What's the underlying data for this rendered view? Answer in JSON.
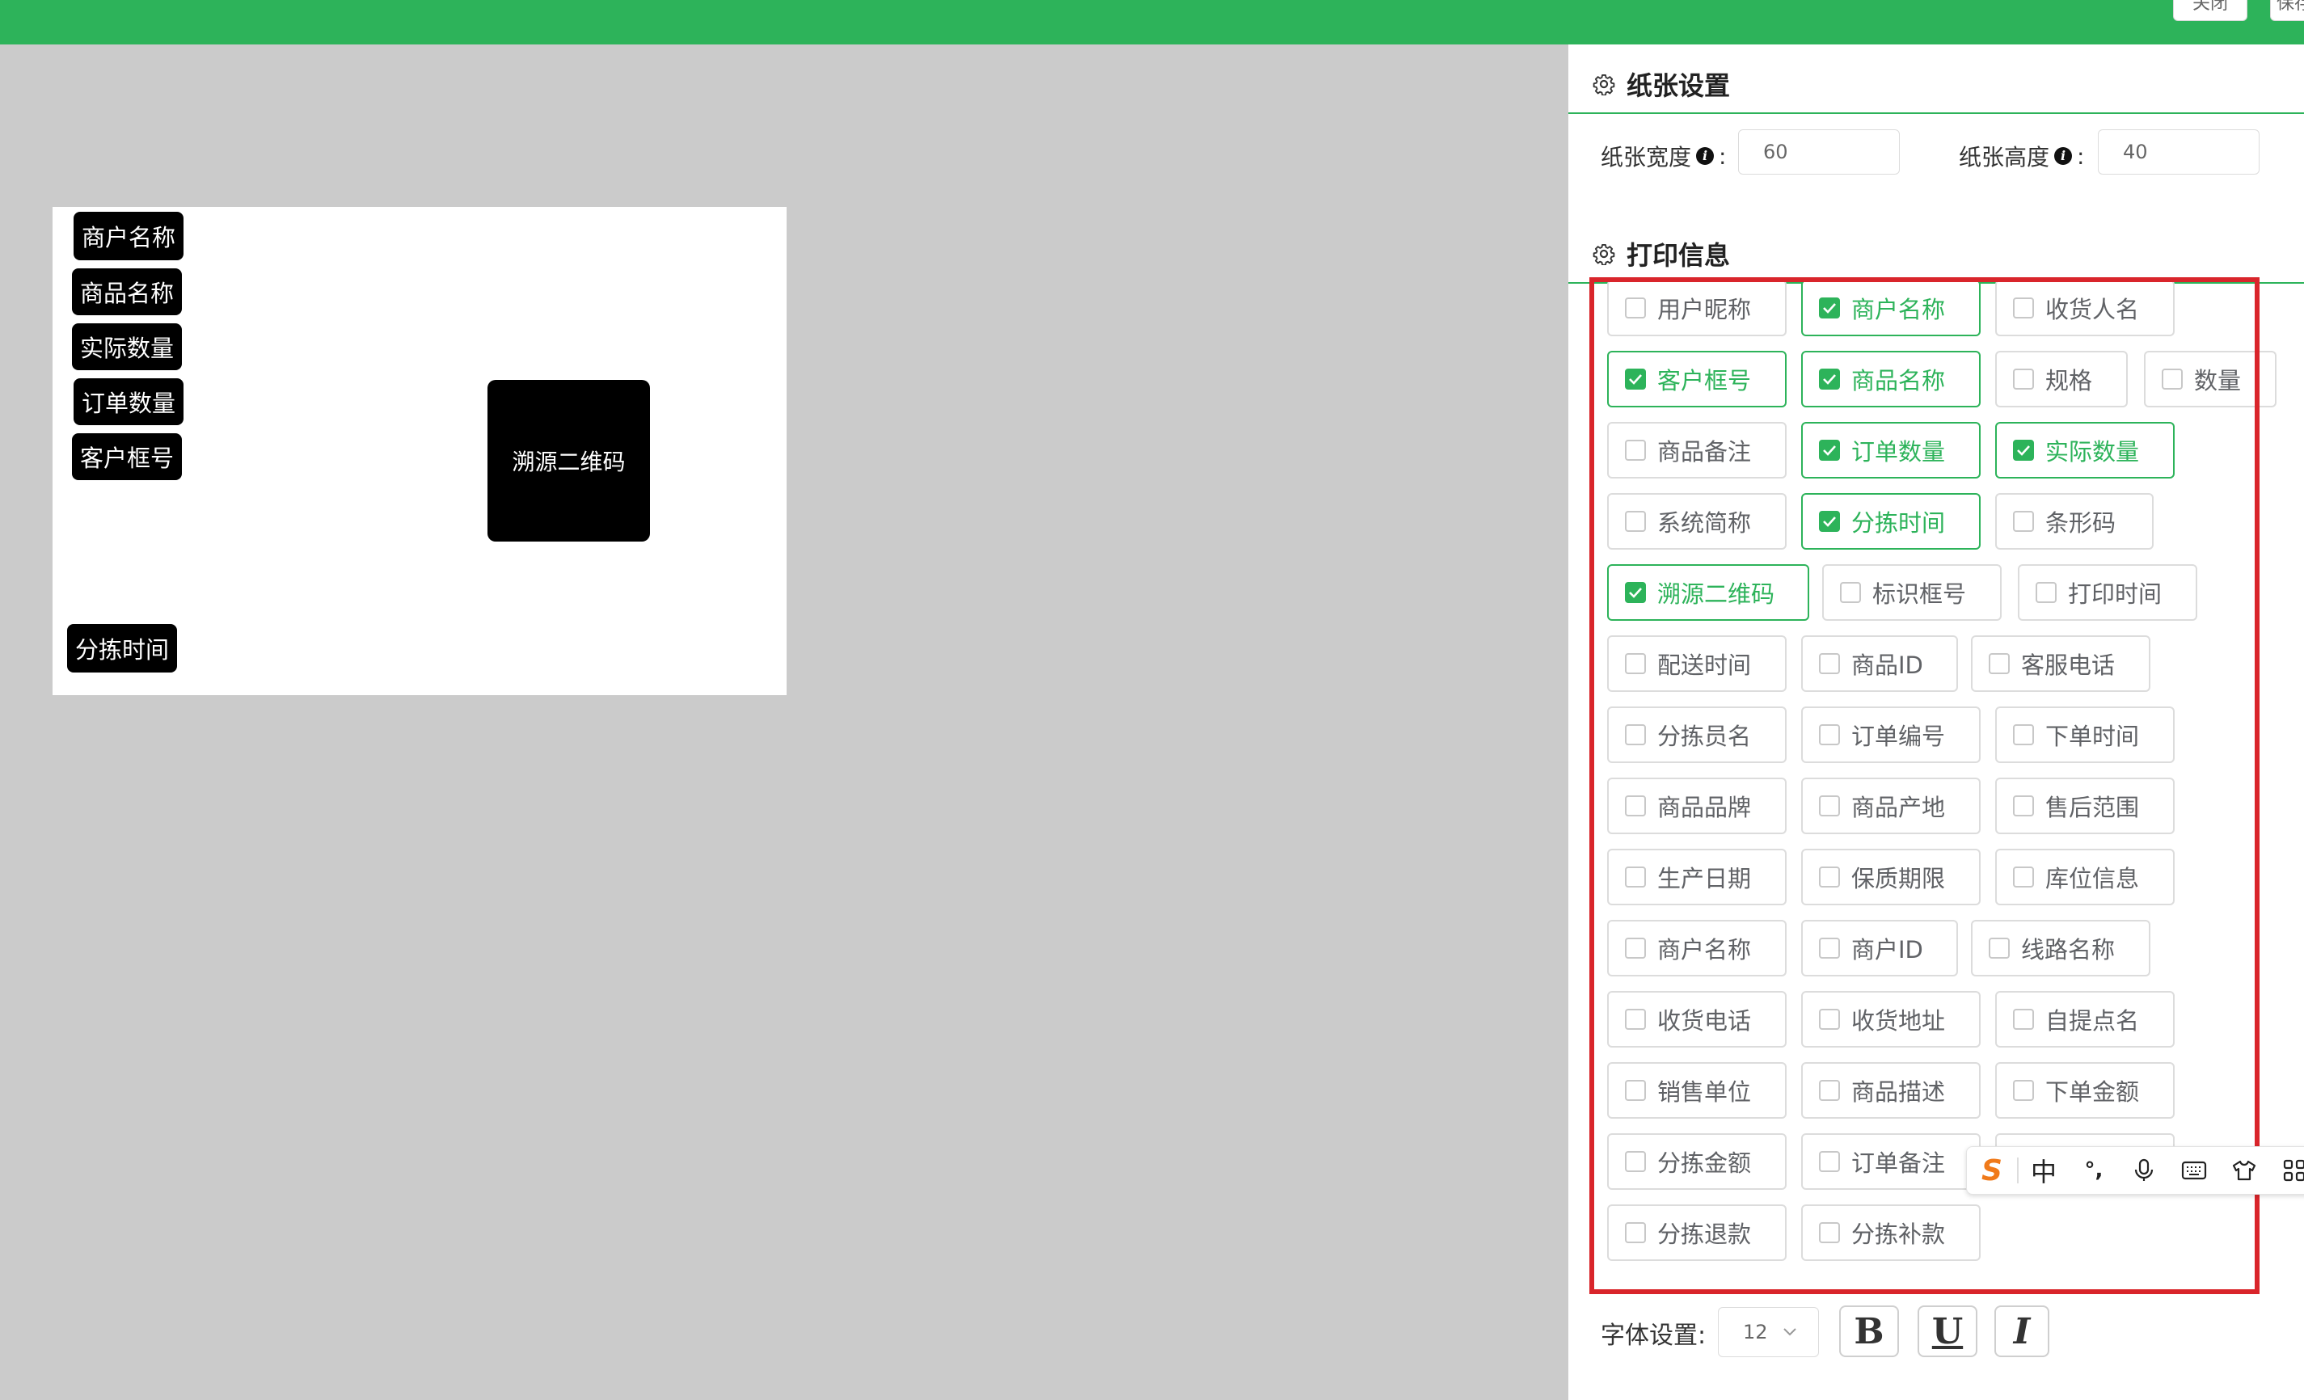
{
  "topbar": {
    "close_label": "关闭",
    "save_label": "保存",
    "bg_color": "#2db35a"
  },
  "canvas": {
    "fields": [
      "商户名称",
      "商品名称",
      "实际数量",
      "订单数量",
      "客户框号"
    ],
    "qr_label": "溯源二维码",
    "sort_time_label": "分拣时间"
  },
  "paper": {
    "title": "纸张设置",
    "width_label": "纸张宽度",
    "width_value": "60",
    "height_label": "纸张高度",
    "height_value": "40",
    "colon": ":"
  },
  "print_info": {
    "title": "打印信息",
    "options": [
      {
        "label": "用户昵称",
        "checked": false
      },
      {
        "label": "商户名称",
        "checked": true
      },
      {
        "label": "收货人名",
        "checked": false
      },
      {
        "label": "客户框号",
        "checked": true
      },
      {
        "label": "商品名称",
        "checked": true
      },
      {
        "label": "规格",
        "checked": false
      },
      {
        "label": "数量",
        "checked": false
      },
      {
        "label": "商品备注",
        "checked": false
      },
      {
        "label": "订单数量",
        "checked": true
      },
      {
        "label": "实际数量",
        "checked": true
      },
      {
        "label": "系统简称",
        "checked": false
      },
      {
        "label": "分拣时间",
        "checked": true
      },
      {
        "label": "条形码",
        "checked": false
      },
      {
        "label": "溯源二维码",
        "checked": true
      },
      {
        "label": "标识框号",
        "checked": false
      },
      {
        "label": "打印时间",
        "checked": false
      },
      {
        "label": "配送时间",
        "checked": false
      },
      {
        "label": "商品ID",
        "checked": false
      },
      {
        "label": "客服电话",
        "checked": false
      },
      {
        "label": "分拣员名",
        "checked": false
      },
      {
        "label": "订单编号",
        "checked": false
      },
      {
        "label": "下单时间",
        "checked": false
      },
      {
        "label": "商品品牌",
        "checked": false
      },
      {
        "label": "商品产地",
        "checked": false
      },
      {
        "label": "售后范围",
        "checked": false
      },
      {
        "label": "生产日期",
        "checked": false
      },
      {
        "label": "保质期限",
        "checked": false
      },
      {
        "label": "库位信息",
        "checked": false
      },
      {
        "label": "商户名称",
        "checked": false
      },
      {
        "label": "商户ID",
        "checked": false
      },
      {
        "label": "线路名称",
        "checked": false
      },
      {
        "label": "收货电话",
        "checked": false
      },
      {
        "label": "收货地址",
        "checked": false
      },
      {
        "label": "自提点名",
        "checked": false
      },
      {
        "label": "销售单位",
        "checked": false
      },
      {
        "label": "商品描述",
        "checked": false
      },
      {
        "label": "下单金额",
        "checked": false
      },
      {
        "label": "分拣金额",
        "checked": false
      },
      {
        "label": "订单备注",
        "checked": false
      },
      {
        "label": "",
        "checked": false
      },
      {
        "label": "分拣退款",
        "checked": false
      },
      {
        "label": "分拣补款",
        "checked": false
      }
    ]
  },
  "font": {
    "label": "字体设置:",
    "size": "12",
    "bold": "B",
    "underline": "U",
    "italic": "I"
  },
  "ime": {
    "logo": "S",
    "chinese": "中",
    "punct": "°,"
  },
  "colors": {
    "accent": "#2db35a",
    "highlight_border": "#d9252b",
    "canvas_bg": "#cbcbcb"
  }
}
